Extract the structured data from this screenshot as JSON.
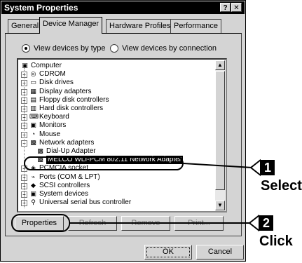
{
  "window": {
    "title": "System Properties",
    "help_glyph": "?",
    "close_glyph": "✕"
  },
  "tabs": [
    {
      "label": "General"
    },
    {
      "label": "Device Manager"
    },
    {
      "label": "Hardware Profiles"
    },
    {
      "label": "Performance"
    }
  ],
  "view_options": {
    "by_type": "View devices by type",
    "by_connection": "View devices by connection",
    "selected": "by_type"
  },
  "tree": [
    {
      "label": "Computer",
      "icon": "computer-icon",
      "expander": ""
    },
    {
      "label": "CDROM",
      "icon": "cdrom-icon",
      "expander": "+"
    },
    {
      "label": "Disk drives",
      "icon": "disk-drive-icon",
      "expander": "+"
    },
    {
      "label": "Display adapters",
      "icon": "display-adapter-icon",
      "expander": "+"
    },
    {
      "label": "Floppy disk controllers",
      "icon": "floppy-controller-icon",
      "expander": "+"
    },
    {
      "label": "Hard disk controllers",
      "icon": "hard-disk-controller-icon",
      "expander": "+"
    },
    {
      "label": "Keyboard",
      "icon": "keyboard-icon",
      "expander": "+"
    },
    {
      "label": "Monitors",
      "icon": "monitor-icon",
      "expander": "+"
    },
    {
      "label": "Mouse",
      "icon": "mouse-icon",
      "expander": "+"
    },
    {
      "label": "Network adapters",
      "icon": "network-adapter-icon",
      "expander": "−"
    },
    {
      "label": "Dial-Up Adapter",
      "icon": "network-card-icon",
      "expander": ""
    },
    {
      "label": "MELCO WLI-PCM 802.11 Network Adapter",
      "icon": "network-card-icon",
      "expander": "",
      "selected": true
    },
    {
      "label": "PCMCIA socket",
      "icon": "pcmcia-icon",
      "expander": "+"
    },
    {
      "label": "Ports (COM & LPT)",
      "icon": "ports-icon",
      "expander": "+"
    },
    {
      "label": "SCSI controllers",
      "icon": "scsi-icon",
      "expander": "+"
    },
    {
      "label": "System devices",
      "icon": "system-devices-icon",
      "expander": "+"
    },
    {
      "label": "Universal serial bus controller",
      "icon": "usb-icon",
      "expander": "+"
    }
  ],
  "buttons": {
    "properties": "Properties",
    "refresh": "Refresh",
    "remove": "Remove",
    "print": "Print...",
    "ok": "OK",
    "cancel": "Cancel"
  },
  "annotations": {
    "step1_num": "1",
    "step1_text": "Select",
    "step2_num": "2",
    "step2_text": "Click"
  }
}
